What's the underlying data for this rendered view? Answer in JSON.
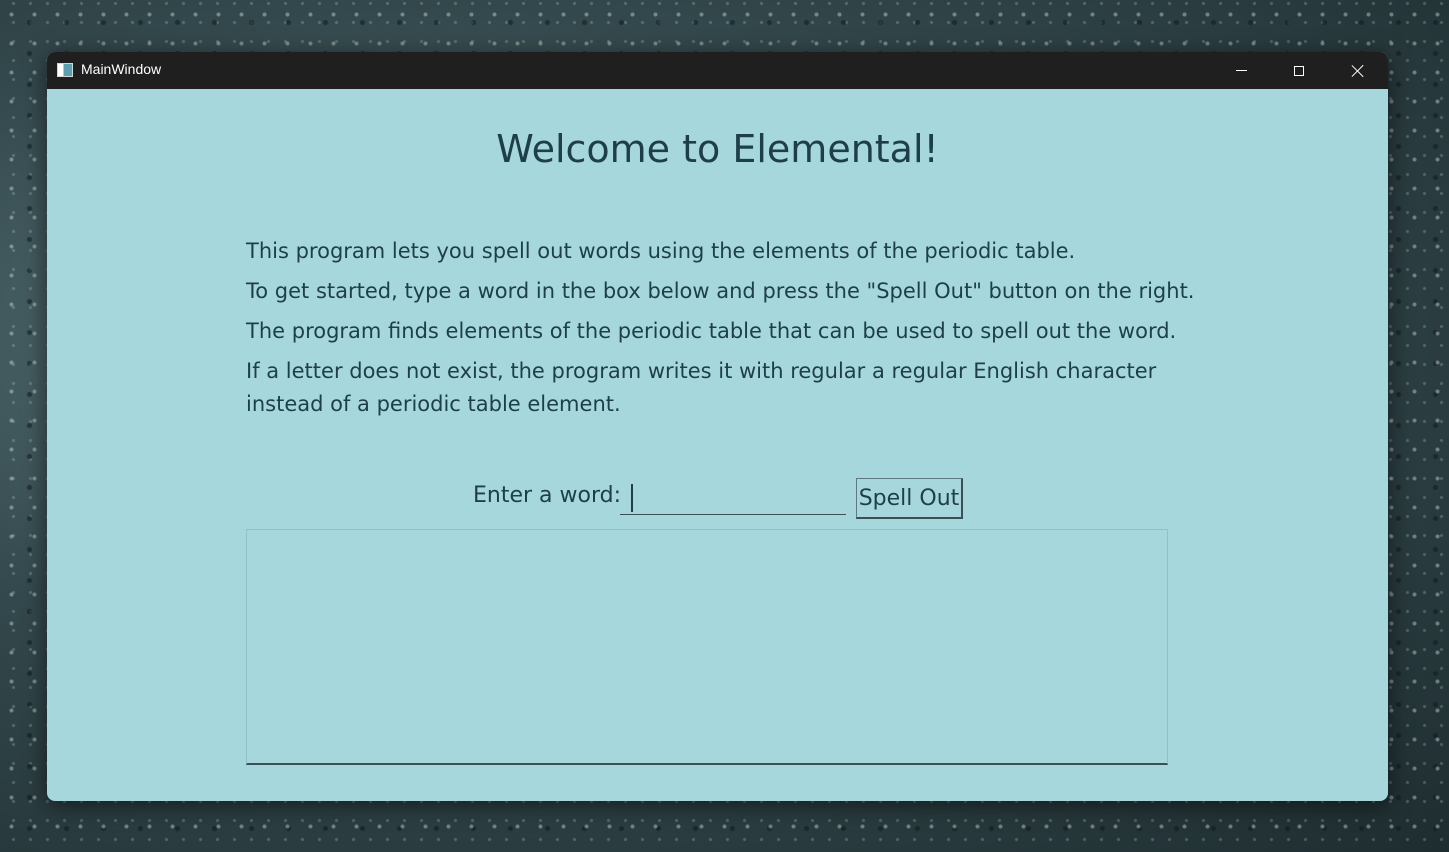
{
  "window": {
    "title": "MainWindow",
    "background": "#a5d7dc"
  },
  "main": {
    "heading": "Welcome to Elemental!",
    "description": [
      "This program lets you spell out words using the elements of the periodic table.",
      "To get started, type a word in the box below and press the \"Spell Out\" button on the right.",
      "The program finds elements of the periodic table that can be used to spell out the word.",
      "If a letter does not exist, the program writes it with regular a regular English character instead of a periodic table element."
    ],
    "word_label": "Enter a word:",
    "word_value": "",
    "spell_button": "Spell Out",
    "output_text": ""
  },
  "icons": {
    "app": "app-window-icon",
    "minimize": "minimize-icon",
    "maximize": "maximize-icon",
    "close": "close-icon"
  }
}
